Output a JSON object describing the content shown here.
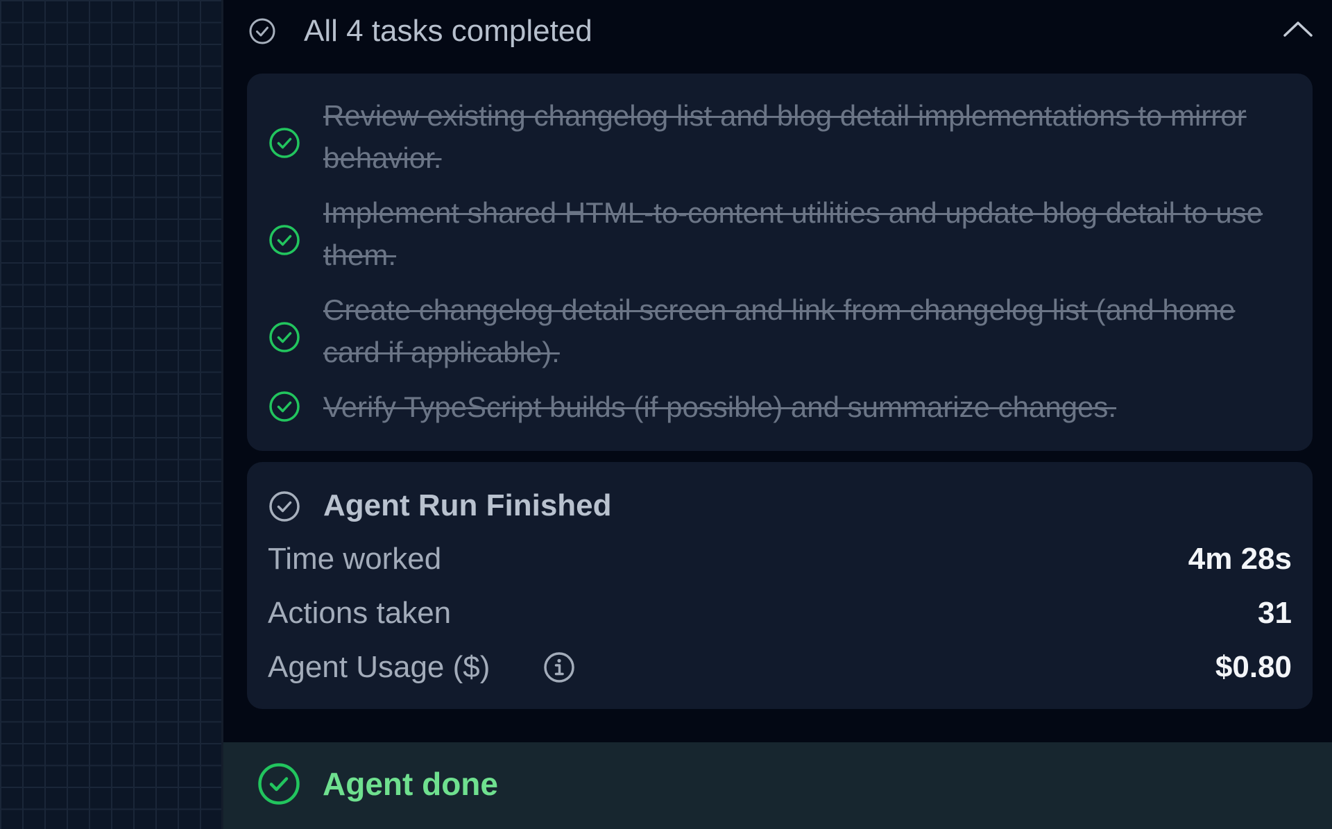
{
  "header": {
    "title": "All 4 tasks completed",
    "status_icon": "check-circle-outline-icon",
    "collapse_icon": "chevron-up-icon"
  },
  "tasks": [
    {
      "text": "Review existing changelog list and blog detail implementations to mirror behavior.",
      "completed": true
    },
    {
      "text": "Implement shared HTML-to-content utilities and update blog detail to use them.",
      "completed": true
    },
    {
      "text": "Create changelog detail screen and link from changelog list (and home card if applicable).",
      "completed": true
    },
    {
      "text": "Verify TypeScript builds (if possible) and summarize changes.",
      "completed": true
    }
  ],
  "summary": {
    "title": "Agent Run Finished",
    "stats": {
      "time_worked": {
        "label": "Time worked",
        "value": "4m 28s"
      },
      "actions_taken": {
        "label": "Actions taken",
        "value": "31"
      },
      "agent_usage": {
        "label": "Agent Usage ($)",
        "value": "$0.80"
      }
    }
  },
  "footer": {
    "label": "Agent done",
    "icon": "check-circle-icon"
  },
  "colors": {
    "background": "#030814",
    "card": "#111a2c",
    "success_green": "#22c55e",
    "done_text": "#6fe08f",
    "done_bar": "#17262f",
    "muted_text": "#6b7586"
  }
}
